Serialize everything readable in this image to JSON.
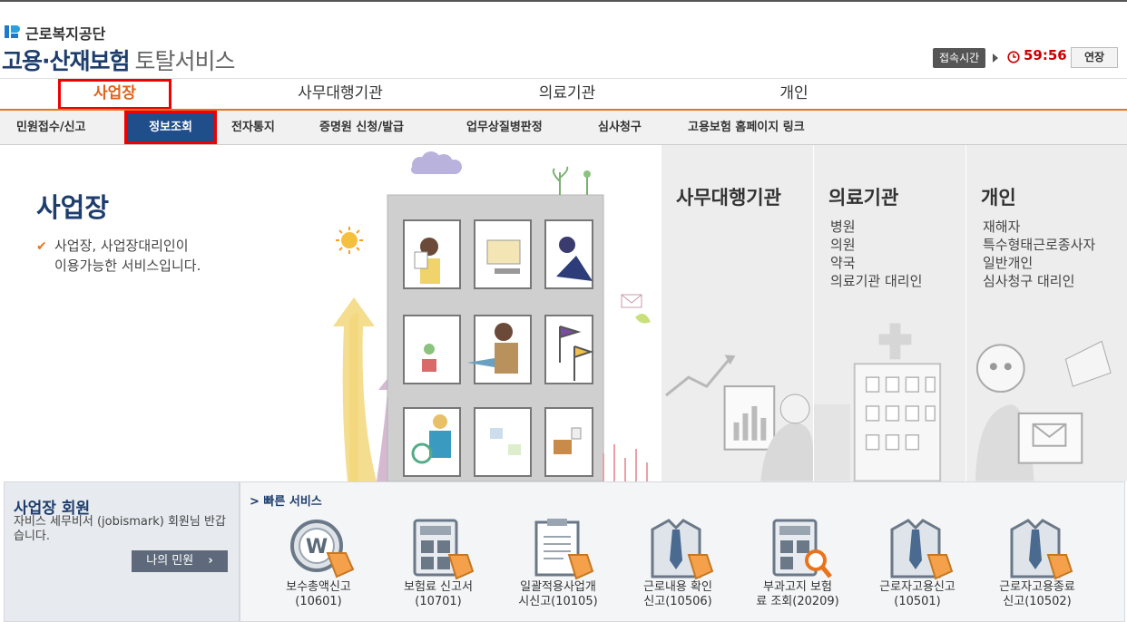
{
  "header": {
    "org_name": "근로복지공단",
    "service_main": "고용·산재보험",
    "service_sub": "토탈서비스",
    "session_label": "접속시간",
    "timer": "59:56",
    "extend_label": "연장"
  },
  "main_tabs": [
    {
      "label": "사업장",
      "active": true
    },
    {
      "label": "사무대행기관",
      "active": false
    },
    {
      "label": "의료기관",
      "active": false
    },
    {
      "label": "개인",
      "active": false
    }
  ],
  "sub_menu": [
    {
      "label": "민원접수/신고",
      "active": false
    },
    {
      "label": "정보조회",
      "active": true
    },
    {
      "label": "전자통지",
      "active": false
    },
    {
      "label": "증명원 신청/발급",
      "active": false
    },
    {
      "label": "업무상질병판정",
      "active": false
    },
    {
      "label": "심사청구",
      "active": false
    },
    {
      "label": "고용보험 홈페이지 링크",
      "active": false
    }
  ],
  "hero": {
    "title": "사업장",
    "desc_line1": "사업장, 사업장대리인이",
    "desc_line2": "이용가능한 서비스입니다."
  },
  "panels": [
    {
      "title": "사무대행기관",
      "items": []
    },
    {
      "title": "의료기관",
      "items": [
        "병원",
        "의원",
        "약국",
        "의료기관 대리인"
      ]
    },
    {
      "title": "개인",
      "items": [
        "재해자",
        "특수형태근로종사자",
        "일반개인",
        "심사청구 대리인"
      ]
    }
  ],
  "member": {
    "title": "사업장 회원",
    "message": "자비스 세무비서 (jobismark) 회원님 반갑습니다.",
    "my_button": "나의 민원"
  },
  "quick": {
    "title": "> 빠른 서비스",
    "items": [
      {
        "line1": "보수총액신고",
        "line2": "(10601)",
        "icon": "coin-icon"
      },
      {
        "line1": "보험료 신고서",
        "line2": "(10701)",
        "icon": "calculator-icon"
      },
      {
        "line1": "일괄적용사업개",
        "line2": "시신고(10105)",
        "icon": "document-icon"
      },
      {
        "line1": "근로내용 확인",
        "line2": "신고(10506)",
        "icon": "worker-icon"
      },
      {
        "line1": "부과고지 보험",
        "line2": "료 조회(20209)",
        "icon": "calculator-search-icon"
      },
      {
        "line1": "근로자고용신고",
        "line2": "(10501)",
        "icon": "worker-icon"
      },
      {
        "line1": "근로자고용종료",
        "line2": "신고(10502)",
        "icon": "worker-icon"
      }
    ]
  },
  "colors": {
    "accent": "#e8741c",
    "navy": "#1d3d6c",
    "active_sub": "#1f4e8a",
    "highlight": "#ee0000"
  }
}
